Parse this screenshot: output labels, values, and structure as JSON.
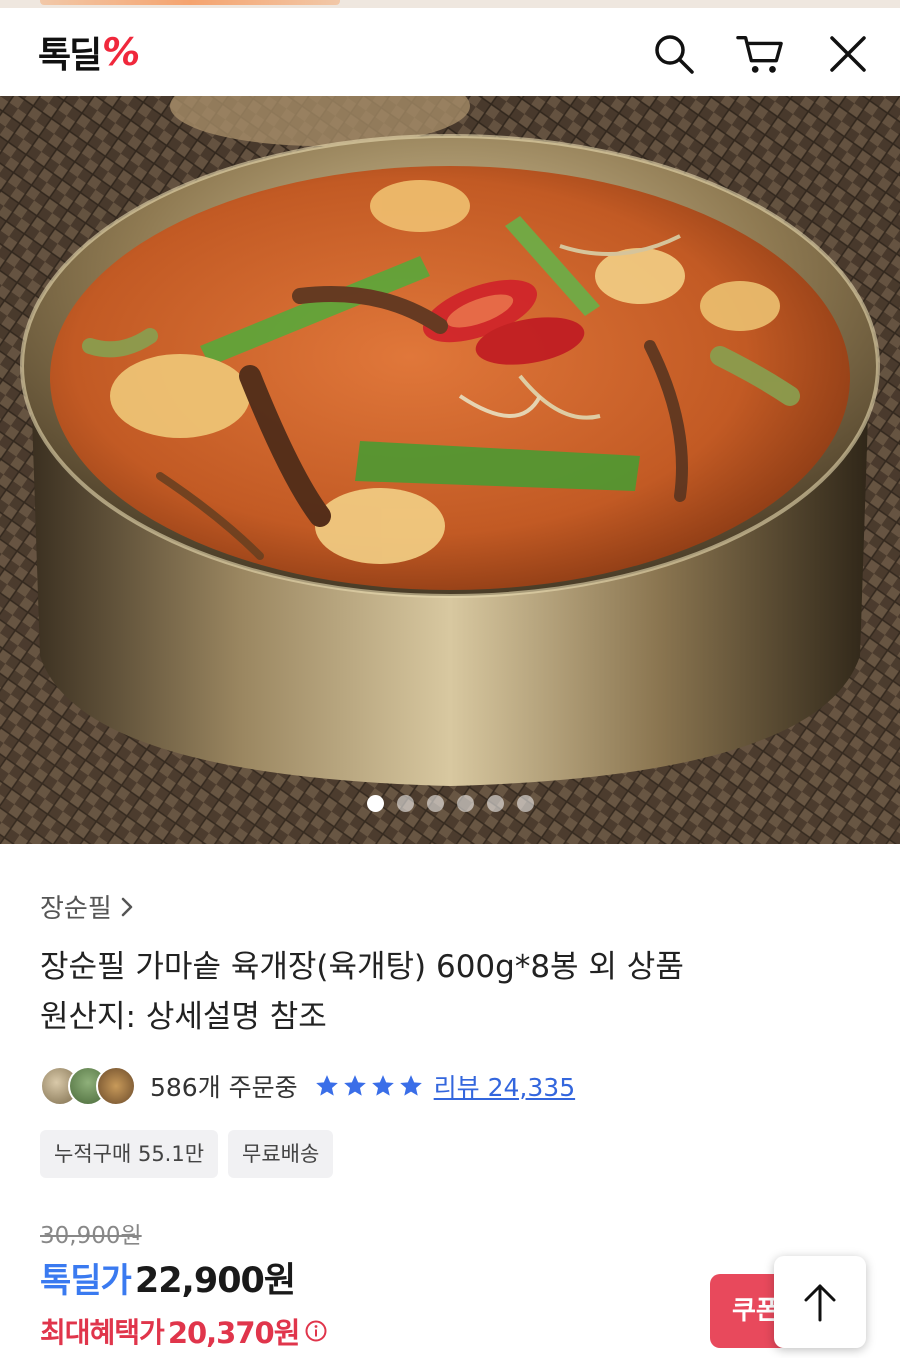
{
  "header": {
    "logo_text": "톡딜",
    "logo_mark": "%",
    "icons": [
      "search-icon",
      "cart-icon",
      "close-icon"
    ]
  },
  "gallery": {
    "image_alt": "육개장 product photo",
    "page_count": 6,
    "active_index": 0
  },
  "product": {
    "brand": "장순필",
    "brand_chevron": "›",
    "title_line1": "장순필 가마솥 육개장(육개탕) 600g*8봉 외 상품",
    "title_line2": "원산지: 상세설명 참조",
    "orders_text": "586개 주문중",
    "rating_stars": 4,
    "reviews_text": "리뷰 24,335",
    "tags": [
      "누적구매 55.1만",
      "무료배송"
    ],
    "original_price": "30,900원",
    "price_label": "톡딜가",
    "price_value": "22,900원",
    "max_benefit_label": "최대혜택가",
    "max_benefit_value": "20,370원"
  },
  "floating": {
    "coupon_label": "쿠폰",
    "top_icon": "arrow-up-icon"
  },
  "colors": {
    "accent_red": "#f0283c",
    "price_blue": "#3a7af0",
    "benefit_red": "#e0354b",
    "review_blue": "#3366dd"
  }
}
